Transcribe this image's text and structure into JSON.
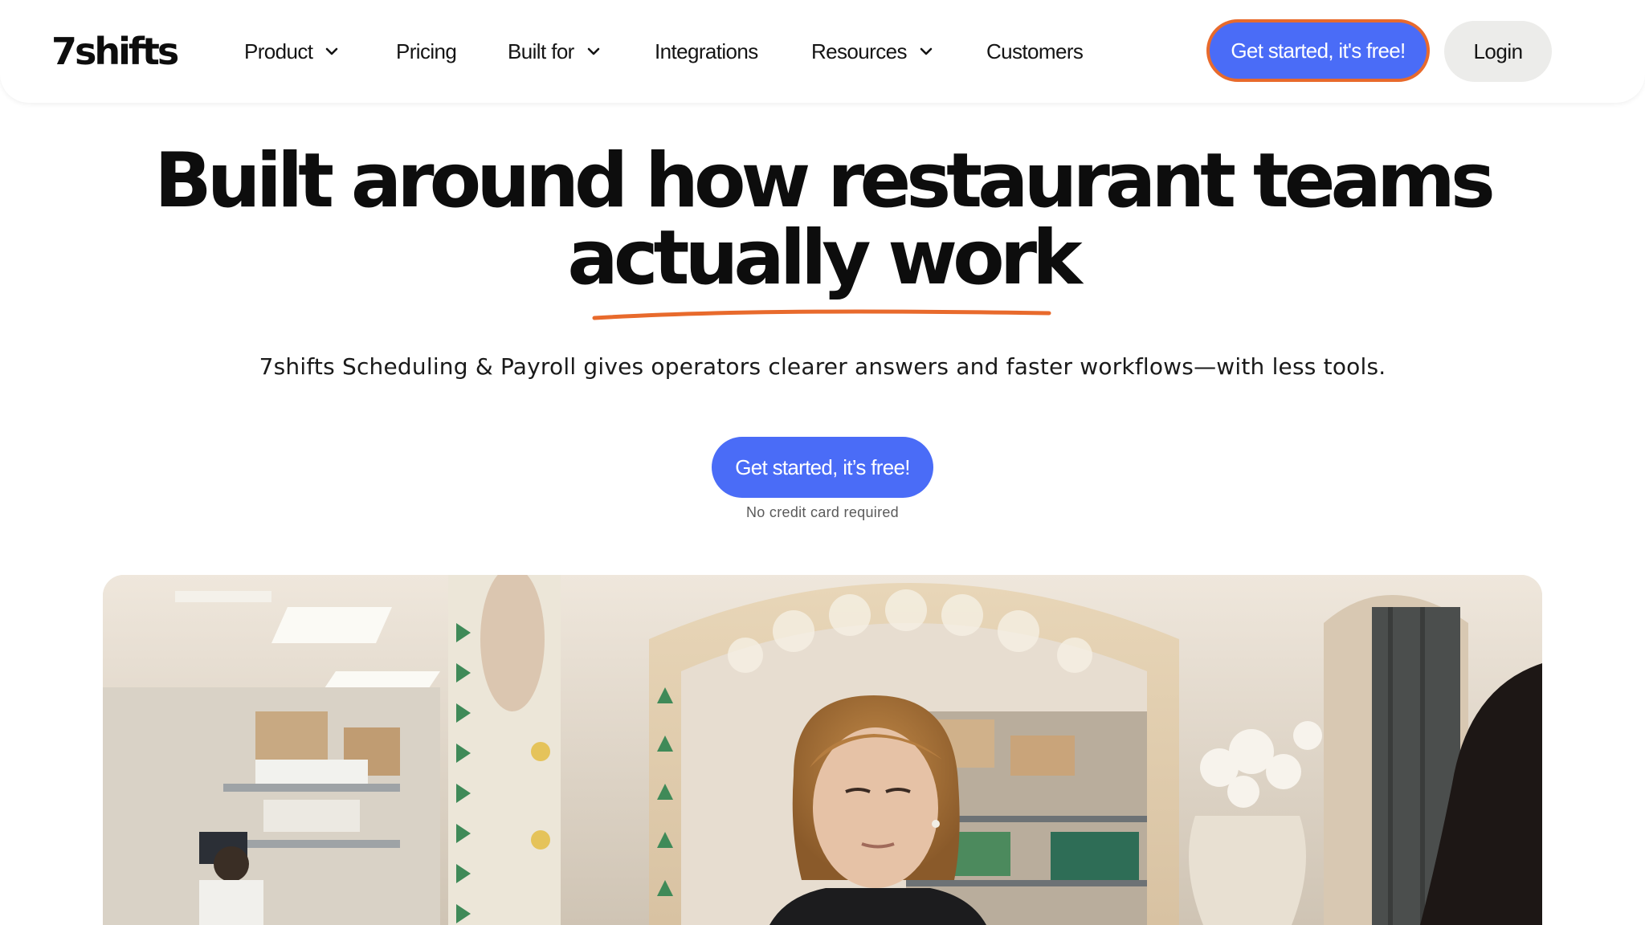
{
  "header": {
    "logo": "7shifts",
    "nav": [
      {
        "label": "Product",
        "has_dropdown": true,
        "icon": "chevron-down-icon"
      },
      {
        "label": "Pricing",
        "has_dropdown": false
      },
      {
        "label": "Built for",
        "has_dropdown": true,
        "icon": "chevron-down-icon"
      },
      {
        "label": "Integrations",
        "has_dropdown": false
      },
      {
        "label": "Resources",
        "has_dropdown": true,
        "icon": "chevron-down-icon"
      },
      {
        "label": "Customers",
        "has_dropdown": false
      }
    ],
    "cta_label": "Get started, it's free!",
    "login_label": "Login"
  },
  "hero": {
    "title_line1": "Built around how restaurant teams",
    "title_line2": "actually work",
    "subtitle": "7shifts Scheduling & Payroll gives operators clearer answers and faster workflows—with less tools.",
    "cta_label": "Get started, it’s free!",
    "note": "No credit card required"
  },
  "colors": {
    "accent_blue": "#4a6cf7",
    "accent_orange": "#e86a2c",
    "text": "#141414",
    "login_bg": "#ececea"
  }
}
